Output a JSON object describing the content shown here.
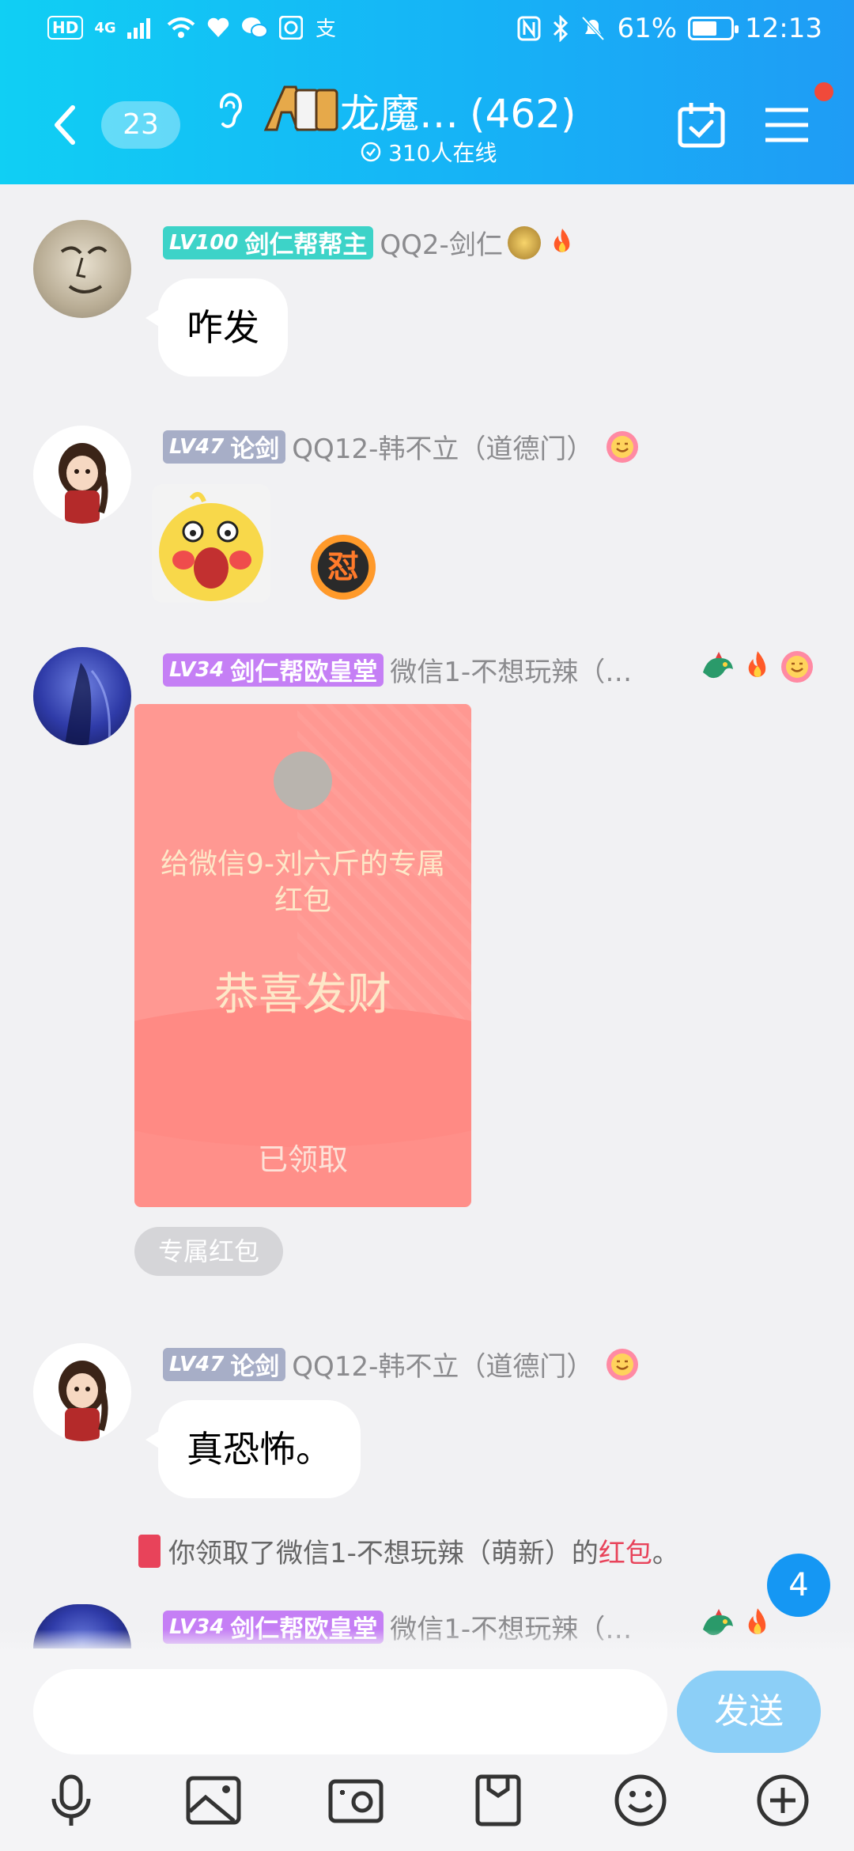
{
  "status_bar": {
    "left_badges": [
      "HD",
      "4G"
    ],
    "battery": "61%",
    "time": "12:13"
  },
  "header": {
    "unread_count": "23",
    "group_name": "龙魔…",
    "member_count": "(462)",
    "online_text": "310人在线"
  },
  "messages": [
    {
      "lv": "LV100",
      "title": "剑仁帮帮主",
      "nickname": "QQ2-剑仁",
      "text": "咋发"
    },
    {
      "lv": "LV47",
      "title": "论剑",
      "nickname": "QQ12-韩不立（道德门）",
      "sticker_caption": "怼"
    },
    {
      "lv": "LV34",
      "title": "剑仁帮欧皇堂",
      "nickname": "微信1-不想玩辣（…",
      "red_packet": {
        "to": "给微信9-刘六斤的专属红包",
        "wish": "恭喜发财",
        "status": "已领取",
        "tag": "专属红包"
      }
    },
    {
      "lv": "LV47",
      "title": "论剑",
      "nickname": "QQ12-韩不立（道德门）",
      "text": "真恐怖。"
    },
    {
      "lv": "LV34",
      "title": "剑仁帮欧皇堂",
      "nickname": "微信1-不想玩辣（…"
    }
  ],
  "system_note": {
    "prefix": "你领取了微信1-不想玩辣（萌新）的",
    "link": "红包",
    "suffix": "。"
  },
  "new_message_count": "4",
  "input": {
    "value": "",
    "send_label": "发送"
  },
  "toolbar_icons": [
    "microphone-icon",
    "image-icon",
    "camera-icon",
    "file-icon",
    "emoji-icon",
    "plus-icon"
  ],
  "colors": {
    "header_start": "#10cff4",
    "header_end": "#1f9cf5",
    "level_teal": "#3dd3c8",
    "level_gray": "#a7aec7",
    "level_purple": "#c57ff5",
    "red_packet": "#ff9892",
    "send_button": "#8ccff7",
    "badge_blue": "#1597f3"
  }
}
